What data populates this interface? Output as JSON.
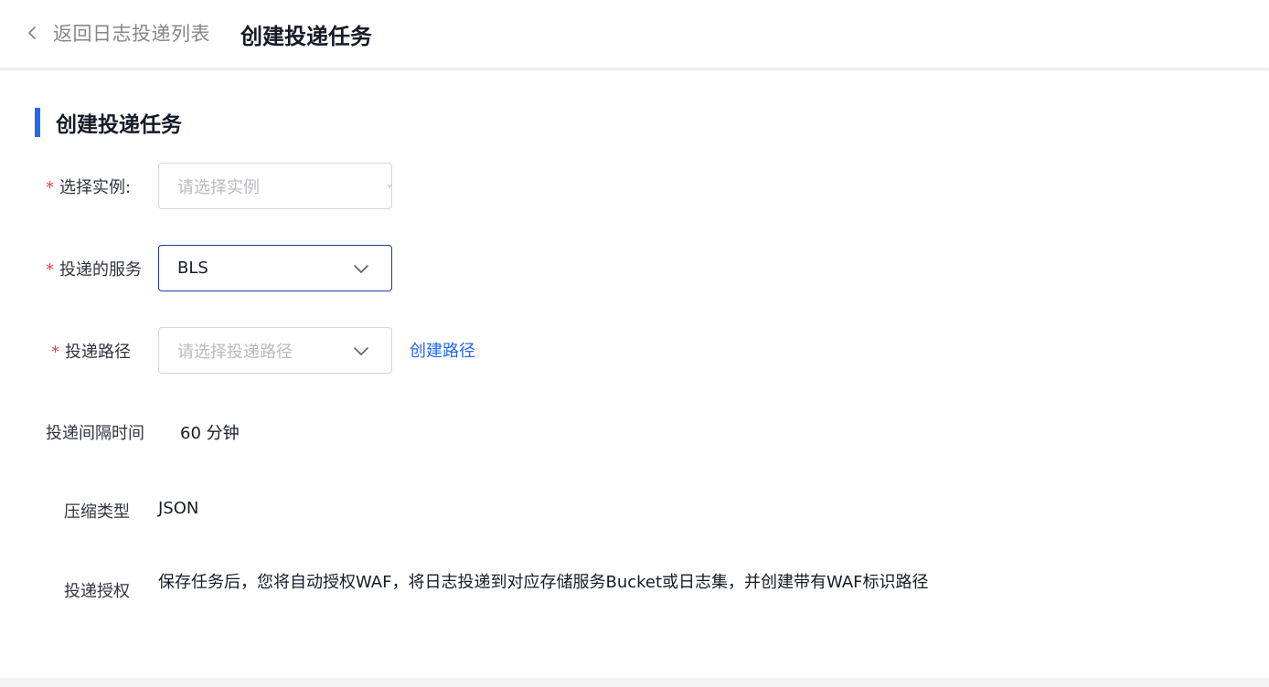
{
  "header": {
    "back_label": "返回日志投递列表",
    "title": "创建投递任务"
  },
  "section": {
    "title": "创建投递任务"
  },
  "form": {
    "required_mark": "*",
    "instance": {
      "label": "选择实例:",
      "placeholder": "请选择实例"
    },
    "service": {
      "label": "投递的服务",
      "value": "BLS"
    },
    "path": {
      "label": "投递路径",
      "placeholder": "请选择投递路径",
      "create_link": "创建路径"
    },
    "interval": {
      "label": "投递间隔时间",
      "value": "60 分钟"
    },
    "compression": {
      "label": "压缩类型",
      "value": "JSON"
    },
    "auth": {
      "label": "投递授权",
      "text": "保存任务后，您将自动授权WAF，将日志投递到对应存储服务Bucket或日志集，并创建带有WAF标识路径"
    }
  },
  "colors": {
    "accent": "#2468f2",
    "required": "#f33e3e",
    "active_border": "#1e3c9c"
  },
  "icons": [
    "back-arrow-icon",
    "chevron-down-icon"
  ]
}
